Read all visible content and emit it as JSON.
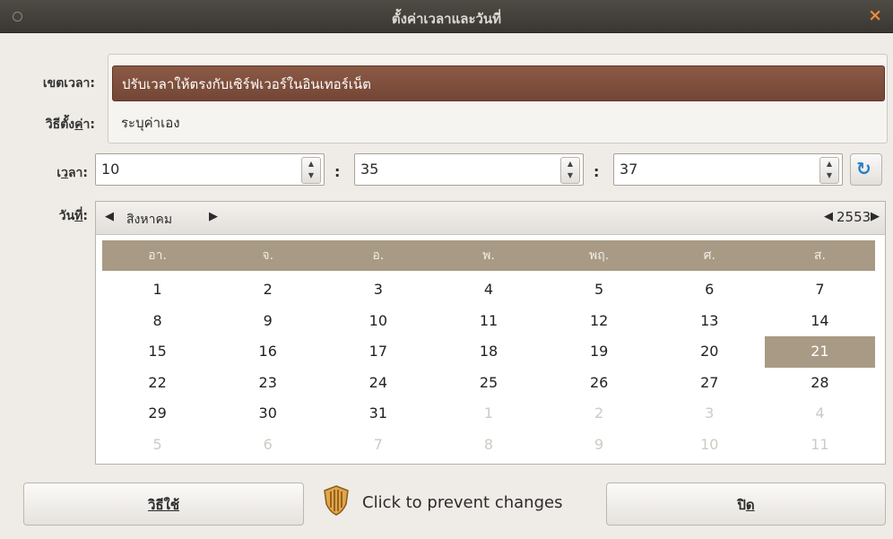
{
  "window": {
    "title": "ตั้งค่าเวลาและวันที่",
    "close_glyph": "×"
  },
  "labels": {
    "timezone": "เขตเวลา:",
    "method_pre": "วิธีตั้ง",
    "method_u": "ค่",
    "method_post": "า:",
    "time_pre": "เ",
    "time_u": "ว",
    "time_post": "ลา:",
    "date_pre": "วัน",
    "date_u": "ที่",
    "date_post": ":"
  },
  "method_options": [
    {
      "label": "ปรับเวลาให้ตรงกับเซิร์ฟเวอร์ในอินเทอร์เน็ต",
      "selected": true
    },
    {
      "label": "ระบุค่าเอง",
      "selected": false
    }
  ],
  "time": {
    "hour": "10",
    "minute": "35",
    "second": "37",
    "separator": ":"
  },
  "calendar": {
    "month": "สิงหาคม",
    "year": "2553",
    "weekdays": [
      "อา.",
      "จ.",
      "อ.",
      "พ.",
      "พฤ.",
      "ศ.",
      "ส."
    ],
    "weeks": [
      [
        {
          "d": "1"
        },
        {
          "d": "2"
        },
        {
          "d": "3"
        },
        {
          "d": "4"
        },
        {
          "d": "5"
        },
        {
          "d": "6"
        },
        {
          "d": "7"
        }
      ],
      [
        {
          "d": "8"
        },
        {
          "d": "9"
        },
        {
          "d": "10"
        },
        {
          "d": "11"
        },
        {
          "d": "12"
        },
        {
          "d": "13"
        },
        {
          "d": "14"
        }
      ],
      [
        {
          "d": "15"
        },
        {
          "d": "16"
        },
        {
          "d": "17"
        },
        {
          "d": "18"
        },
        {
          "d": "19"
        },
        {
          "d": "20"
        },
        {
          "d": "21",
          "today": true
        }
      ],
      [
        {
          "d": "22"
        },
        {
          "d": "23"
        },
        {
          "d": "24"
        },
        {
          "d": "25"
        },
        {
          "d": "26"
        },
        {
          "d": "27"
        },
        {
          "d": "28"
        }
      ],
      [
        {
          "d": "29"
        },
        {
          "d": "30"
        },
        {
          "d": "31"
        },
        {
          "d": "1",
          "other": true
        },
        {
          "d": "2",
          "other": true
        },
        {
          "d": "3",
          "other": true
        },
        {
          "d": "4",
          "other": true
        }
      ],
      [
        {
          "d": "5",
          "other": true
        },
        {
          "d": "6",
          "other": true
        },
        {
          "d": "7",
          "other": true
        },
        {
          "d": "8",
          "other": true
        },
        {
          "d": "9",
          "other": true
        },
        {
          "d": "10",
          "other": true
        },
        {
          "d": "11",
          "other": true
        }
      ]
    ]
  },
  "buttons": {
    "help": "วิธีใช้",
    "lock_text": "Click to prevent changes",
    "close_pre": "ปิ",
    "close_u": "ด"
  },
  "colors": {
    "accent": "#7a4a38",
    "calendar_header": "#a89a84",
    "refresh_icon": "#2a7fc1"
  },
  "icons": {
    "refresh": "refresh-icon",
    "lock": "shield-lock-icon"
  }
}
